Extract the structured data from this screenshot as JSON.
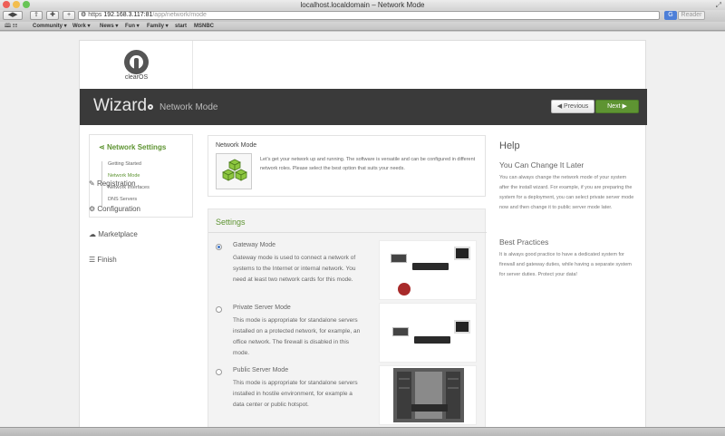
{
  "browser": {
    "window_title": "localhost.localdomain – Network Mode",
    "url_https": "https",
    "url_host": "192.168.3.117:81",
    "url_path": "/app/network/mode",
    "search_label": "G",
    "reader_label": "Reader",
    "bookmarks": [
      "Community ▾",
      "Work ▾",
      "News ▾",
      "Fun ▾",
      "Family ▾",
      "start",
      "MSNBC"
    ]
  },
  "logo": {
    "text": "clearOS"
  },
  "header": {
    "title": "Wizard",
    "subtitle": "Network Mode",
    "prev_label": "Previous",
    "next_label": "Next"
  },
  "sidebar": {
    "section_title": "Network Settings",
    "sub_items": [
      "Getting Started",
      "Network Mode",
      "Network Interfaces",
      "DNS Servers"
    ],
    "active_index": 1,
    "main_items": [
      "Registration",
      "Configuration",
      "Marketplace",
      "Finish"
    ]
  },
  "network_mode": {
    "title": "Network Mode",
    "description": "Let's get your network up and running. The software is versatile and can be configured in different network roles. Please select the best option that suits your needs."
  },
  "settings": {
    "title": "Settings",
    "modes": [
      {
        "name": "Gateway Mode",
        "selected": true,
        "description": "Gateway mode is used to connect a network of systems to the Internet or internal network. You need at least two network cards for this mode."
      },
      {
        "name": "Private Server Mode",
        "selected": false,
        "description": "This mode is appropriate for standalone servers installed on a protected network, for example, an office network. The firewall is disabled in this mode."
      },
      {
        "name": "Public Server Mode",
        "selected": false,
        "description": "This mode is appropriate for standalone servers installed in hostile environment, for example a data center or public hotspot."
      }
    ]
  },
  "help": {
    "title": "Help",
    "sections": [
      {
        "heading": "You Can Change It Later",
        "text": "You can always change the network mode of your system after the install wizard. For example, if you are preparing the system for a deployment, you can select private server mode now and then change it to public server mode later."
      },
      {
        "heading": "Best Practices",
        "text": "It is always good practice to have a dedicated system for firewall and gateway duties, while having a separate system for server duties. Protect your data!"
      }
    ]
  },
  "colors": {
    "accent": "#5e9432",
    "header_bg": "#3a3a3a",
    "radio_selected": "#3b73c8"
  }
}
